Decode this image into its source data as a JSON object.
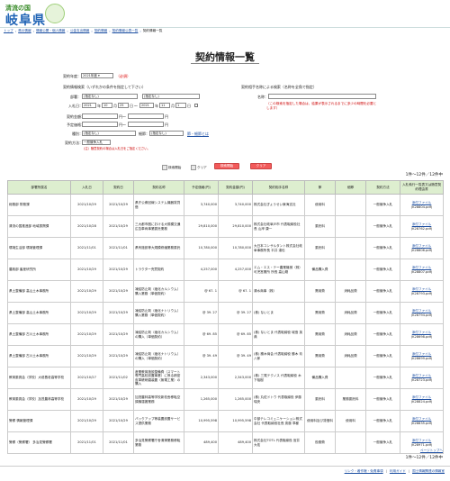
{
  "header": {
    "logo_top": "清流の国",
    "logo_main": "岐阜県"
  },
  "breadcrumb": [
    {
      "label": "トップ",
      "link": true
    },
    {
      "label": "県の情報",
      "link": true
    },
    {
      "label": "情報公開・個人情報",
      "link": true
    },
    {
      "label": "公金支出情報",
      "link": true
    },
    {
      "label": "契約情報",
      "link": true
    },
    {
      "label": "契約情報公表一覧",
      "link": true
    },
    {
      "label": "契約情報一覧",
      "link": false
    }
  ],
  "page_title": "契約情報一覧",
  "form": {
    "fiscal_year_label": "契約年度：",
    "fiscal_year_value": "2021年度",
    "required_mark": "（必須）",
    "section_left": "契約情報検索（いずれかの条件を指定して下さい）",
    "section_right": "契約相手名称による検索（名称を全角で指定）",
    "dept_label": "部署：",
    "dept_value": "(指定なし)",
    "dept_value2": "(指定なし)",
    "date_label": "入札日：",
    "date_from": {
      "y": "2021",
      "m": "10",
      "d": "25"
    },
    "date_to": {
      "y": "2021",
      "m": "11",
      "d": "1"
    },
    "ymd": {
      "y": "年",
      "m": "月",
      "d": "日"
    },
    "tilde": "〜",
    "amount_label": "契約金額：",
    "amount_unit": "円～",
    "amount_unit2": "円",
    "budget_label": "予定価格：",
    "type_label": "種別：",
    "type_value": "(指定なし)",
    "detail_label": "細節：",
    "detail_value": "(指定なし)",
    "detail_link": "節・細節とは",
    "method_label": "契約方法：",
    "method_value": "一般競争入札",
    "note_below_method": "（注）随意契約の場合は入札日をご指定ください。",
    "name_label": "名称：",
    "name_note": "（この検索を指定した場合は、結果が表示されるまでに多少の時間を必要とします）",
    "image_label": "検索開始",
    "clear_label": "クリア",
    "search_btn": "検索開始",
    "clear_btn": "クリア"
  },
  "result_count": "1件～12件／12件中",
  "table": {
    "headers": [
      "部署所属名",
      "入札日",
      "契約日",
      "契約名称",
      "予定価格(円)",
      "契約金額(円)",
      "契約相手名称",
      "節",
      "細節",
      "契約方法",
      "入札執行一覧表又は随意契約理由書"
    ],
    "rows": [
      [
        "総務部 財務課",
        "2021/10/29",
        "2021/10/29",
        "県庁公衆回線システム機器賃貸借",
        "3,740,000",
        "3,740,000",
        "株式会社ぎょうせい東海支社",
        "使用料",
        "",
        "一般競争入札",
        "添付ファイル (K28804.pdf)"
      ],
      [
        "清流の国推進部 地域振興課",
        "2021/10/28",
        "2021/10/29",
        "三大都市圏における大規模交通広告車両事業委託業務",
        "29,810,000",
        "29,810,000",
        "株式会社岐阜戸市 代表取締役社長 山岸 康一",
        "委託料",
        "",
        "一般競争入札",
        "添付ファイル (K28762.pdf)"
      ],
      [
        "環境生活部 環境管理課",
        "2021/11/01",
        "2021/11/01",
        "県有施設等大規模修繕業務委託",
        "10,780,000",
        "10,780,000",
        "大日本コンサルタント株式会社岐阜事務所長 平井 達也",
        "委託料",
        "",
        "一般競争入札",
        "添付ファイル (K28806.pdf)"
      ],
      [
        "農政部 畜産研究所",
        "2021/10/29",
        "2021/10/29",
        "トラクター売買契約",
        "4,257,000",
        "4,257,000",
        "エム・エス・テー農業機械（株）可児営業所 所長 高山剛",
        "備品購入費",
        "",
        "一般競争入札",
        "添付ファイル (K28807.pdf)"
      ],
      [
        "県土整備部 高山土木事務所",
        "2021/10/29",
        "2021/10/29",
        "凍結防止剤（塩化カルシウム）購入業務（単価契約）",
        "@ 67. 1",
        "@ 67. 1",
        "清水商事（株）",
        "需用費",
        "消耗品費",
        "一般競争入札",
        "添付ファイル (K28793.pdf)"
      ],
      [
        "県土整備部 高山土木事務所",
        "2021/10/29",
        "2021/10/29",
        "凍結防止剤（塩化ナトリウム）購入業務（単価契約）",
        "@ 39. 27",
        "@ 39. 27",
        "(株) ないとま",
        "需用費",
        "消耗品費",
        "一般競争入札",
        "添付ファイル (K28794.pdf)"
      ],
      [
        "県土整備部 古川土木事務所",
        "2021/10/29",
        "2021/10/29",
        "凍結防止剤（塩化カルシウム）の購入（単価契約）",
        "@ 69. 85",
        "@ 69. 85",
        "(株) ないとま 代表取締役 城島 英典",
        "需用費",
        "消耗品費",
        "一般競争入札",
        "添付ファイル (K28698.pdf)"
      ],
      [
        "県土整備部 古川土木事務所",
        "2021/10/29",
        "2021/10/29",
        "凍結防止剤（塩化ナトリウム）の購入（単価契約）",
        "@ 39. 49",
        "@ 39. 49",
        "(株) 勝木商会 代表取締役 勝木 玖八郎",
        "需用費",
        "消耗品費",
        "一般競争入札",
        "添付ファイル (K28699.pdf)"
      ],
      [
        "教育委員会（学校）大垣養老高等学校",
        "2021/10/27",
        "2021/11/02",
        "産業教育施設整備費（スマート専門高校設置事業）に係る精密皮革帳研磨装置（無電工業）の購入",
        "2,343,000",
        "2,343,000",
        "(株) 三晃テクノス 代表取締役 木下裕樹",
        "備品購入費",
        "",
        "一般競争入札",
        "添付ファイル (K28723.pdf)"
      ],
      [
        "教育委員会（学校）加茂農林高等学校",
        "2021/10/29",
        "2021/10/29",
        "加茂農林高等学校新校舎移転空調機運搬業務",
        "1,265,000",
        "1,265,000",
        "(株) 丸佐ドトウ 代表取締役 伊藤 瑞央",
        "委託料",
        "業務委託料",
        "一般競争入札",
        "添付ファイル (K28824.pdf)"
      ],
      [
        "警察 情報管理課",
        "2021/10/29",
        "2021/10/29",
        "バックアップ等装置設置サービス提供業務",
        "10,995,598",
        "10,995,598",
        "中部テレコミュニケーション株式会社 代表取締役社長 斎藤 準都",
        "使用料及び賃借料",
        "使用料",
        "一般競争入札",
        "添付ファイル (K28835.pdf)"
      ],
      [
        "警察（警察署） 多治見警察署",
        "2021/11/01",
        "2021/11/01",
        "多治見警察署庁舎清掃業務移転業務",
        "489,400",
        "489,400",
        "株式会社TOTL 代表取締役 宮井 大佑",
        "役務費",
        "",
        "一般競争入札",
        "添付ファイル (K28971.pdf)"
      ]
    ]
  },
  "page_top": "ページトップへ",
  "footer": [
    "リンク・著作権・免責事項",
    "利用ガイド",
    "国土情報関連の情報室"
  ]
}
